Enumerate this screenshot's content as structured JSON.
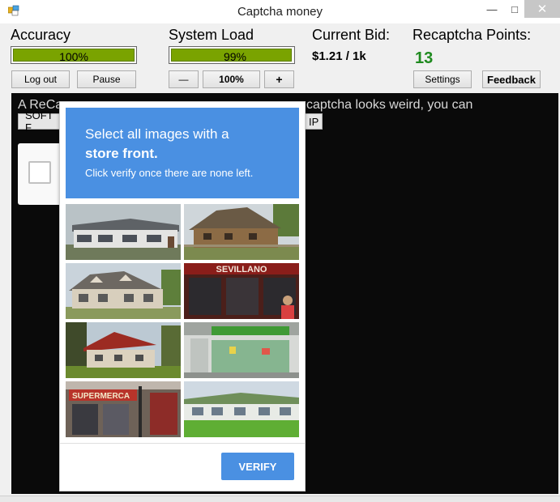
{
  "window": {
    "title": "Captcha money",
    "minimize_glyph": "—",
    "maximize_glyph": "□",
    "close_glyph": "✕"
  },
  "accuracy": {
    "label": "Accuracy",
    "value": "100%",
    "fraction": 1.0
  },
  "system_load": {
    "label": "System Load",
    "value": "99%",
    "fraction": 0.99
  },
  "bid": {
    "label": "Current Bid:",
    "value": "$1.21 / 1k"
  },
  "points": {
    "label": "Recaptcha Points:",
    "value": "13"
  },
  "buttons": {
    "logout": "Log out",
    "pause": "Pause",
    "minus": "—",
    "speed": "100%",
    "plus": "+",
    "settings": "Settings",
    "feedback": "Feedback"
  },
  "pane": {
    "text_left": "A ReCa",
    "text_right": "captcha looks weird, you can",
    "soft_button": "SOFT F",
    "skip_button": "IP"
  },
  "captcha": {
    "line1": "Select all images with a",
    "line2_strong": "store front",
    "line2_suffix": ".",
    "line3": "Click verify once there are none left.",
    "tile_texts": {
      "sevillano": "SEVILLANO",
      "supermercado": "SUPERMERCA"
    },
    "verify": "VERIFY"
  },
  "colors": {
    "accent": "#4a90e2",
    "progress": "#7aa300",
    "points": "#1f8a1f"
  }
}
